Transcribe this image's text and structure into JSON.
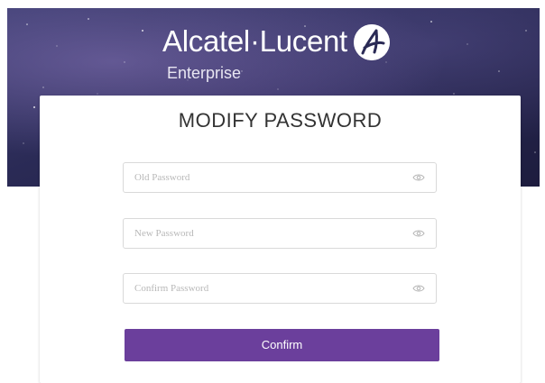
{
  "brand": {
    "name": "Alcatel·Lucent",
    "sub": "Enterprise",
    "logo_icon": "alcatel-lucent-logo-icon"
  },
  "form": {
    "title": "MODIFY PASSWORD",
    "fields": [
      {
        "placeholder": "Old Password",
        "value": "",
        "icon": "eye-icon"
      },
      {
        "placeholder": "New Password",
        "value": "",
        "icon": "eye-icon"
      },
      {
        "placeholder": "Confirm Password",
        "value": "",
        "icon": "eye-icon"
      }
    ],
    "confirm_label": "Confirm"
  },
  "colors": {
    "accent": "#6b3f9c",
    "hero_dark": "#1d1c3e",
    "hero_light": "#3a3b6e"
  }
}
